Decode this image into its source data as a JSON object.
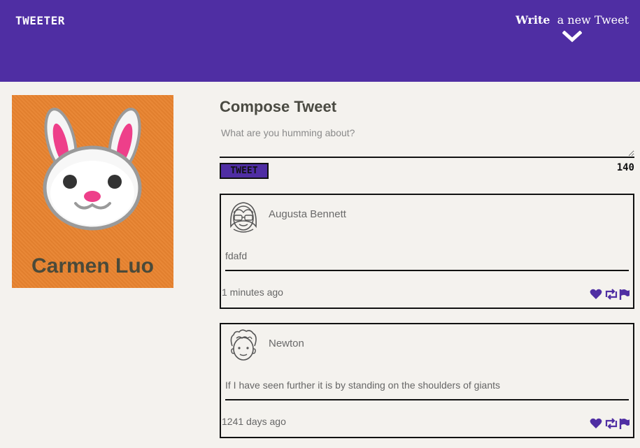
{
  "nav": {
    "logo": "Tweeter",
    "compose_bold": "Write",
    "compose_rest": "a new Tweet",
    "chevron_icon": "chevron-down-icon"
  },
  "profile": {
    "name": "Carmen Luo",
    "avatar_icon": "bunny-avatar"
  },
  "compose": {
    "title": "Compose Tweet",
    "placeholder": "What are you humming about?",
    "button": "Tweet",
    "counter": "140"
  },
  "tweets": [
    {
      "user": "Augusta Bennett",
      "text": "fdafd",
      "time": "1 minutes ago",
      "avatar_icon": "glasses-girl-avatar"
    },
    {
      "user": "Newton",
      "text": "If I have seen further it is by standing on the shoulders of giants",
      "time": "1241 days ago",
      "avatar_icon": "curly-hair-avatar"
    }
  ],
  "actions": [
    "heart-icon",
    "retweet-icon",
    "flag-icon"
  ],
  "colors": {
    "header": "#4f2ea3",
    "background": "#f4f2ee",
    "profile_bg": "#e8832f",
    "action_icons": "#4f2ea3"
  }
}
